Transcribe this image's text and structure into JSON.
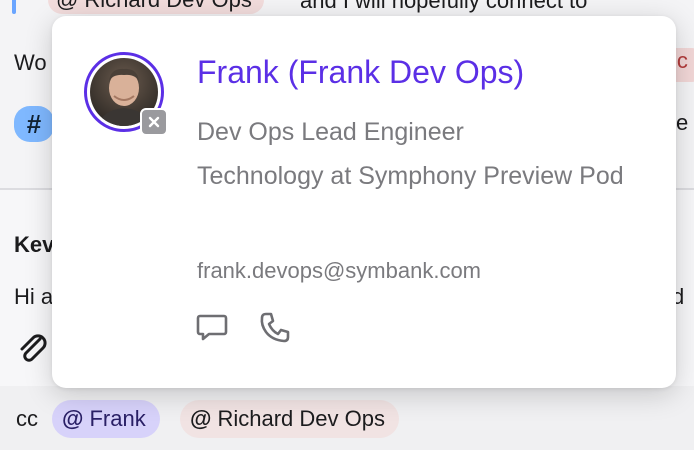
{
  "background": {
    "top_mention": "Richard Dev Ops",
    "top_text": "and I will hopefully connect to",
    "left_fragment_1": "Wo",
    "hash_symbol": "#",
    "right_fragment_1": "ic",
    "right_fragment_2": "e",
    "right_fragment_3": "d",
    "author_fragment": "Kev",
    "message_fragment": "Hi a"
  },
  "footer": {
    "cc_label": "cc",
    "mentions": [
      {
        "label": "Frank"
      },
      {
        "label": "Richard Dev Ops"
      }
    ]
  },
  "profile_card": {
    "name": "Frank (Frank Dev Ops)",
    "job_title": "Dev Ops Lead Engineer",
    "department": "Technology at Symphony Preview Pod",
    "email": "frank.devops@symbank.com",
    "status": "offline",
    "actions": [
      {
        "icon": "chat-bubble-icon"
      },
      {
        "icon": "phone-icon"
      }
    ]
  },
  "colors": {
    "accent": "#5b2fe6",
    "mention_self": "#d7d2fa",
    "mention_other": "#f1e3e3",
    "hashtag": "#7fb8ff",
    "muted_text": "#7a7a7e"
  }
}
